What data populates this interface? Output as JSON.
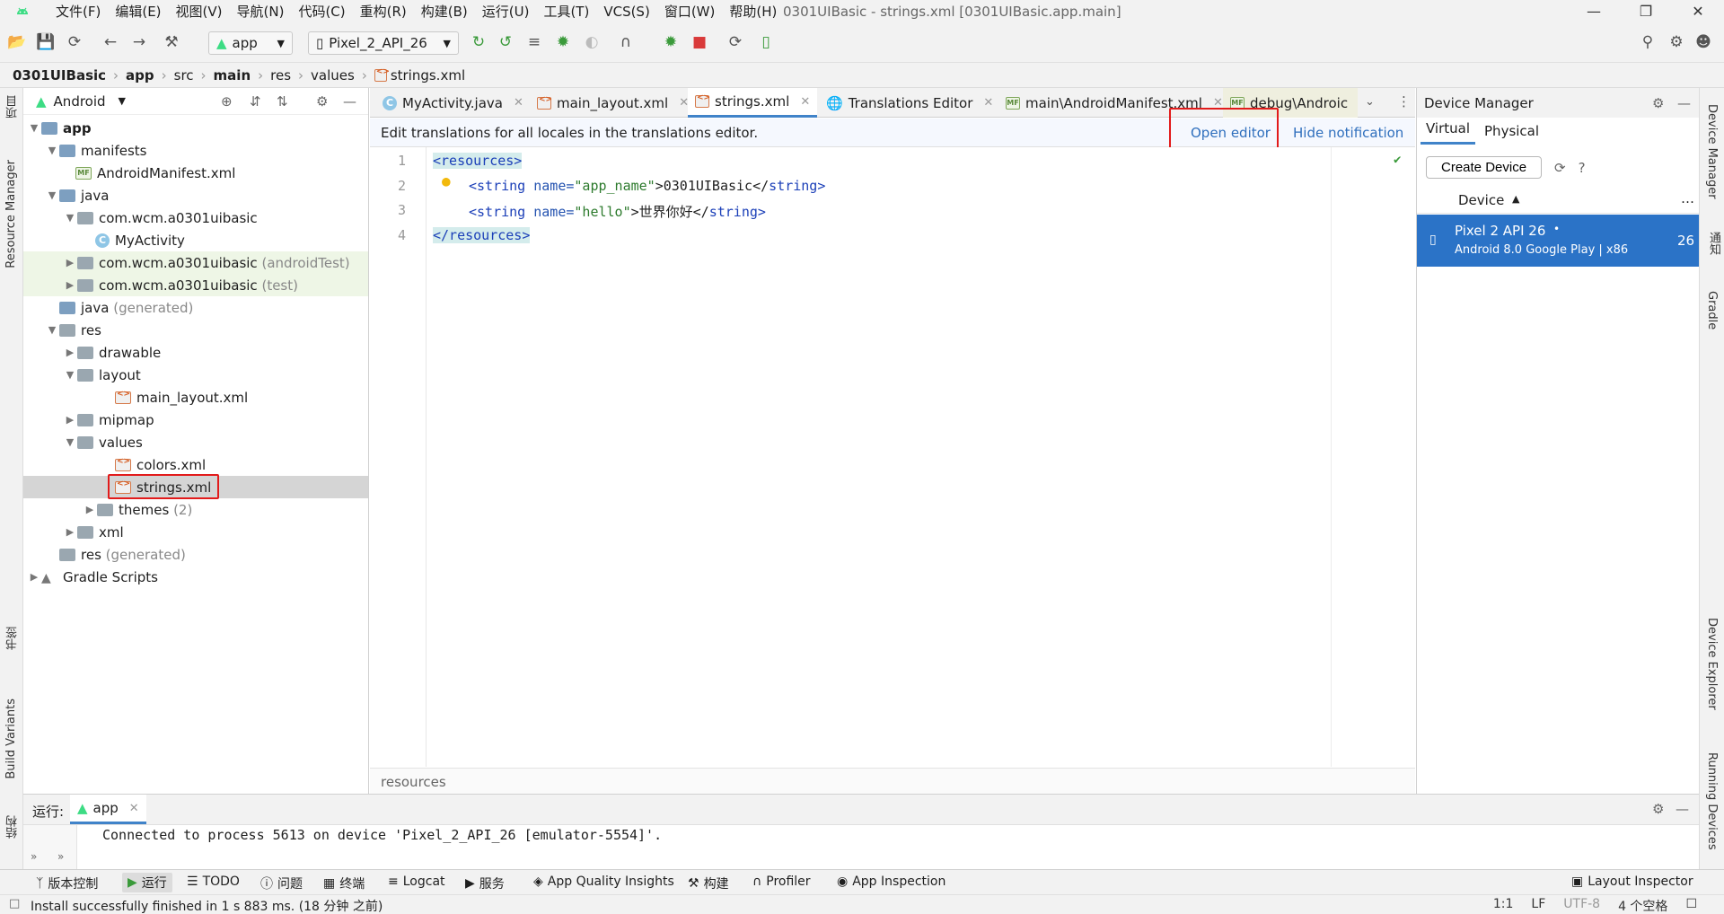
{
  "app": {
    "window_title": "0301UIBasic - strings.xml [0301UIBasic.app.main]",
    "menu": [
      "文件(F)",
      "编辑(E)",
      "视图(V)",
      "导航(N)",
      "代码(C)",
      "重构(R)",
      "构建(B)",
      "运行(U)",
      "工具(T)",
      "VCS(S)",
      "窗口(W)",
      "帮助(H)"
    ]
  },
  "toolbar": {
    "run_config": "app",
    "device": "Pixel_2_API_26"
  },
  "breadcrumb": [
    "0301UIBasic",
    "app",
    "src",
    "main",
    "res",
    "values",
    "strings.xml"
  ],
  "project_panel": {
    "view": "Android",
    "tree": [
      {
        "label": "app",
        "extra": ""
      },
      {
        "label": "manifests",
        "extra": ""
      },
      {
        "label": "AndroidManifest.xml",
        "extra": ""
      },
      {
        "label": "java",
        "extra": ""
      },
      {
        "label": "com.wcm.a0301uibasic",
        "extra": ""
      },
      {
        "label": "MyActivity",
        "extra": ""
      },
      {
        "label": "com.wcm.a0301uibasic",
        "extra": "(androidTest)"
      },
      {
        "label": "com.wcm.a0301uibasic",
        "extra": "(test)"
      },
      {
        "label": "java",
        "extra": "(generated)"
      },
      {
        "label": "res",
        "extra": ""
      },
      {
        "label": "drawable",
        "extra": ""
      },
      {
        "label": "layout",
        "extra": ""
      },
      {
        "label": "main_layout.xml",
        "extra": ""
      },
      {
        "label": "mipmap",
        "extra": ""
      },
      {
        "label": "values",
        "extra": ""
      },
      {
        "label": "colors.xml",
        "extra": ""
      },
      {
        "label": "strings.xml",
        "extra": ""
      },
      {
        "label": "themes",
        "extra": "(2)"
      },
      {
        "label": "xml",
        "extra": ""
      },
      {
        "label": "res",
        "extra": "(generated)"
      },
      {
        "label": "Gradle Scripts",
        "extra": ""
      }
    ]
  },
  "editor": {
    "tabs": [
      "MyActivity.java",
      "main_layout.xml",
      "strings.xml",
      "Translations Editor",
      "main\\AndroidManifest.xml",
      "debug\\Androic"
    ],
    "notification": {
      "message": "Edit translations for all locales in the translations editor.",
      "open_editor": "Open editor",
      "hide": "Hide notification"
    },
    "line_numbers": [
      "1",
      "2",
      "3",
      "4"
    ],
    "code": {
      "l1_tag": "<resources>",
      "l2_open": "<string",
      "l2_attr": "name=",
      "l2_val": "\"app_name\"",
      "l2_text": ">0301UIBasic</",
      "l2_close": "string>",
      "l3_open": "<string",
      "l3_attr": "name=",
      "l3_val": "\"hello\"",
      "l3_text": ">世界你好</",
      "l3_close": "string>",
      "l4_tag": "</resources>"
    },
    "footer": "resources"
  },
  "device_manager": {
    "title": "Device Manager",
    "tabs": [
      "Virtual",
      "Physical"
    ],
    "create_button": "Create Device",
    "column": "Device",
    "devices": [
      {
        "name": "Pixel 2 API 26",
        "detail": "Android 8.0 Google Play | x86",
        "api": "26"
      }
    ]
  },
  "left_stripe": [
    "项目",
    "Resource Manager",
    "书签",
    "Build Variants",
    "结构"
  ],
  "right_stripe": [
    "Device Manager",
    "通知",
    "Gradle",
    "Device Explorer",
    "Running Devices"
  ],
  "run_panel": {
    "label": "运行:",
    "config": "app",
    "output": "Connected to process 5613 on device 'Pixel_2_API_26 [emulator-5554]'."
  },
  "bottom_tools": [
    "版本控制",
    "运行",
    "TODO",
    "问题",
    "终端",
    "Logcat",
    "服务",
    "App Quality Insights",
    "构建",
    "Profiler",
    "App Inspection",
    "Layout Inspector"
  ],
  "status": {
    "message": "Install successfully finished in 1 s 883 ms. (18 分钟 之前)",
    "position": "1:1",
    "line_sep": "LF",
    "encoding": "UTF-8",
    "indent": "4 个空格"
  },
  "colors": {
    "accent": "#4083c9",
    "selection": "#2b73c7",
    "highlight_box": "#e21b1b"
  }
}
